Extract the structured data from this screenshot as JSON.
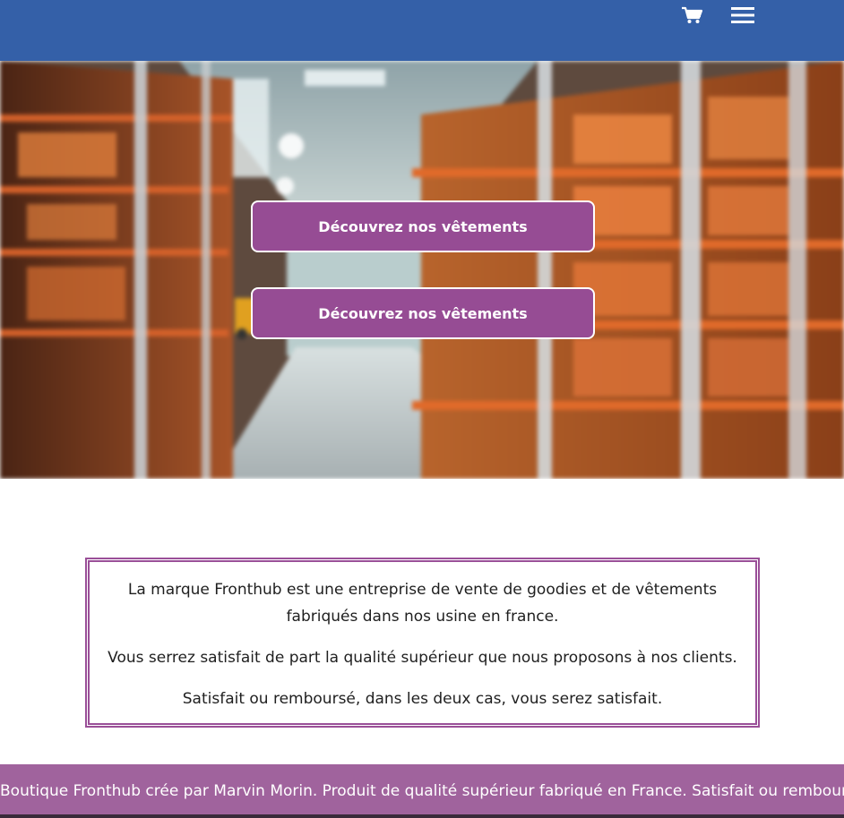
{
  "header": {
    "cart_icon": "shopping-cart-icon",
    "menu_icon": "hamburger-menu-icon",
    "background_color": "#3460a8"
  },
  "hero": {
    "cta_primary_label": "Découvrez nos vêtements",
    "cta_secondary_label": "Découvrez nos vêtements",
    "button_color": "#964c94"
  },
  "about": {
    "paragraph_1": "La marque Fronthub est une entreprise de vente de goodies et de vêtements fabriqués dans nos usine en france.",
    "paragraph_2": "Vous serrez satisfait de part la qualité supérieur que nous proposons à nos clients.",
    "paragraph_3": "Satisfait ou remboursé, dans les deux cas, vous serez satisfait.",
    "border_color": "#9a4f98"
  },
  "footer": {
    "text": "Boutique Fronthub crée par Marvin Morin. Produit de qualité supérieur fabriqué en France. Satisfait ou remboursé.",
    "background_color": "#a0639d"
  }
}
